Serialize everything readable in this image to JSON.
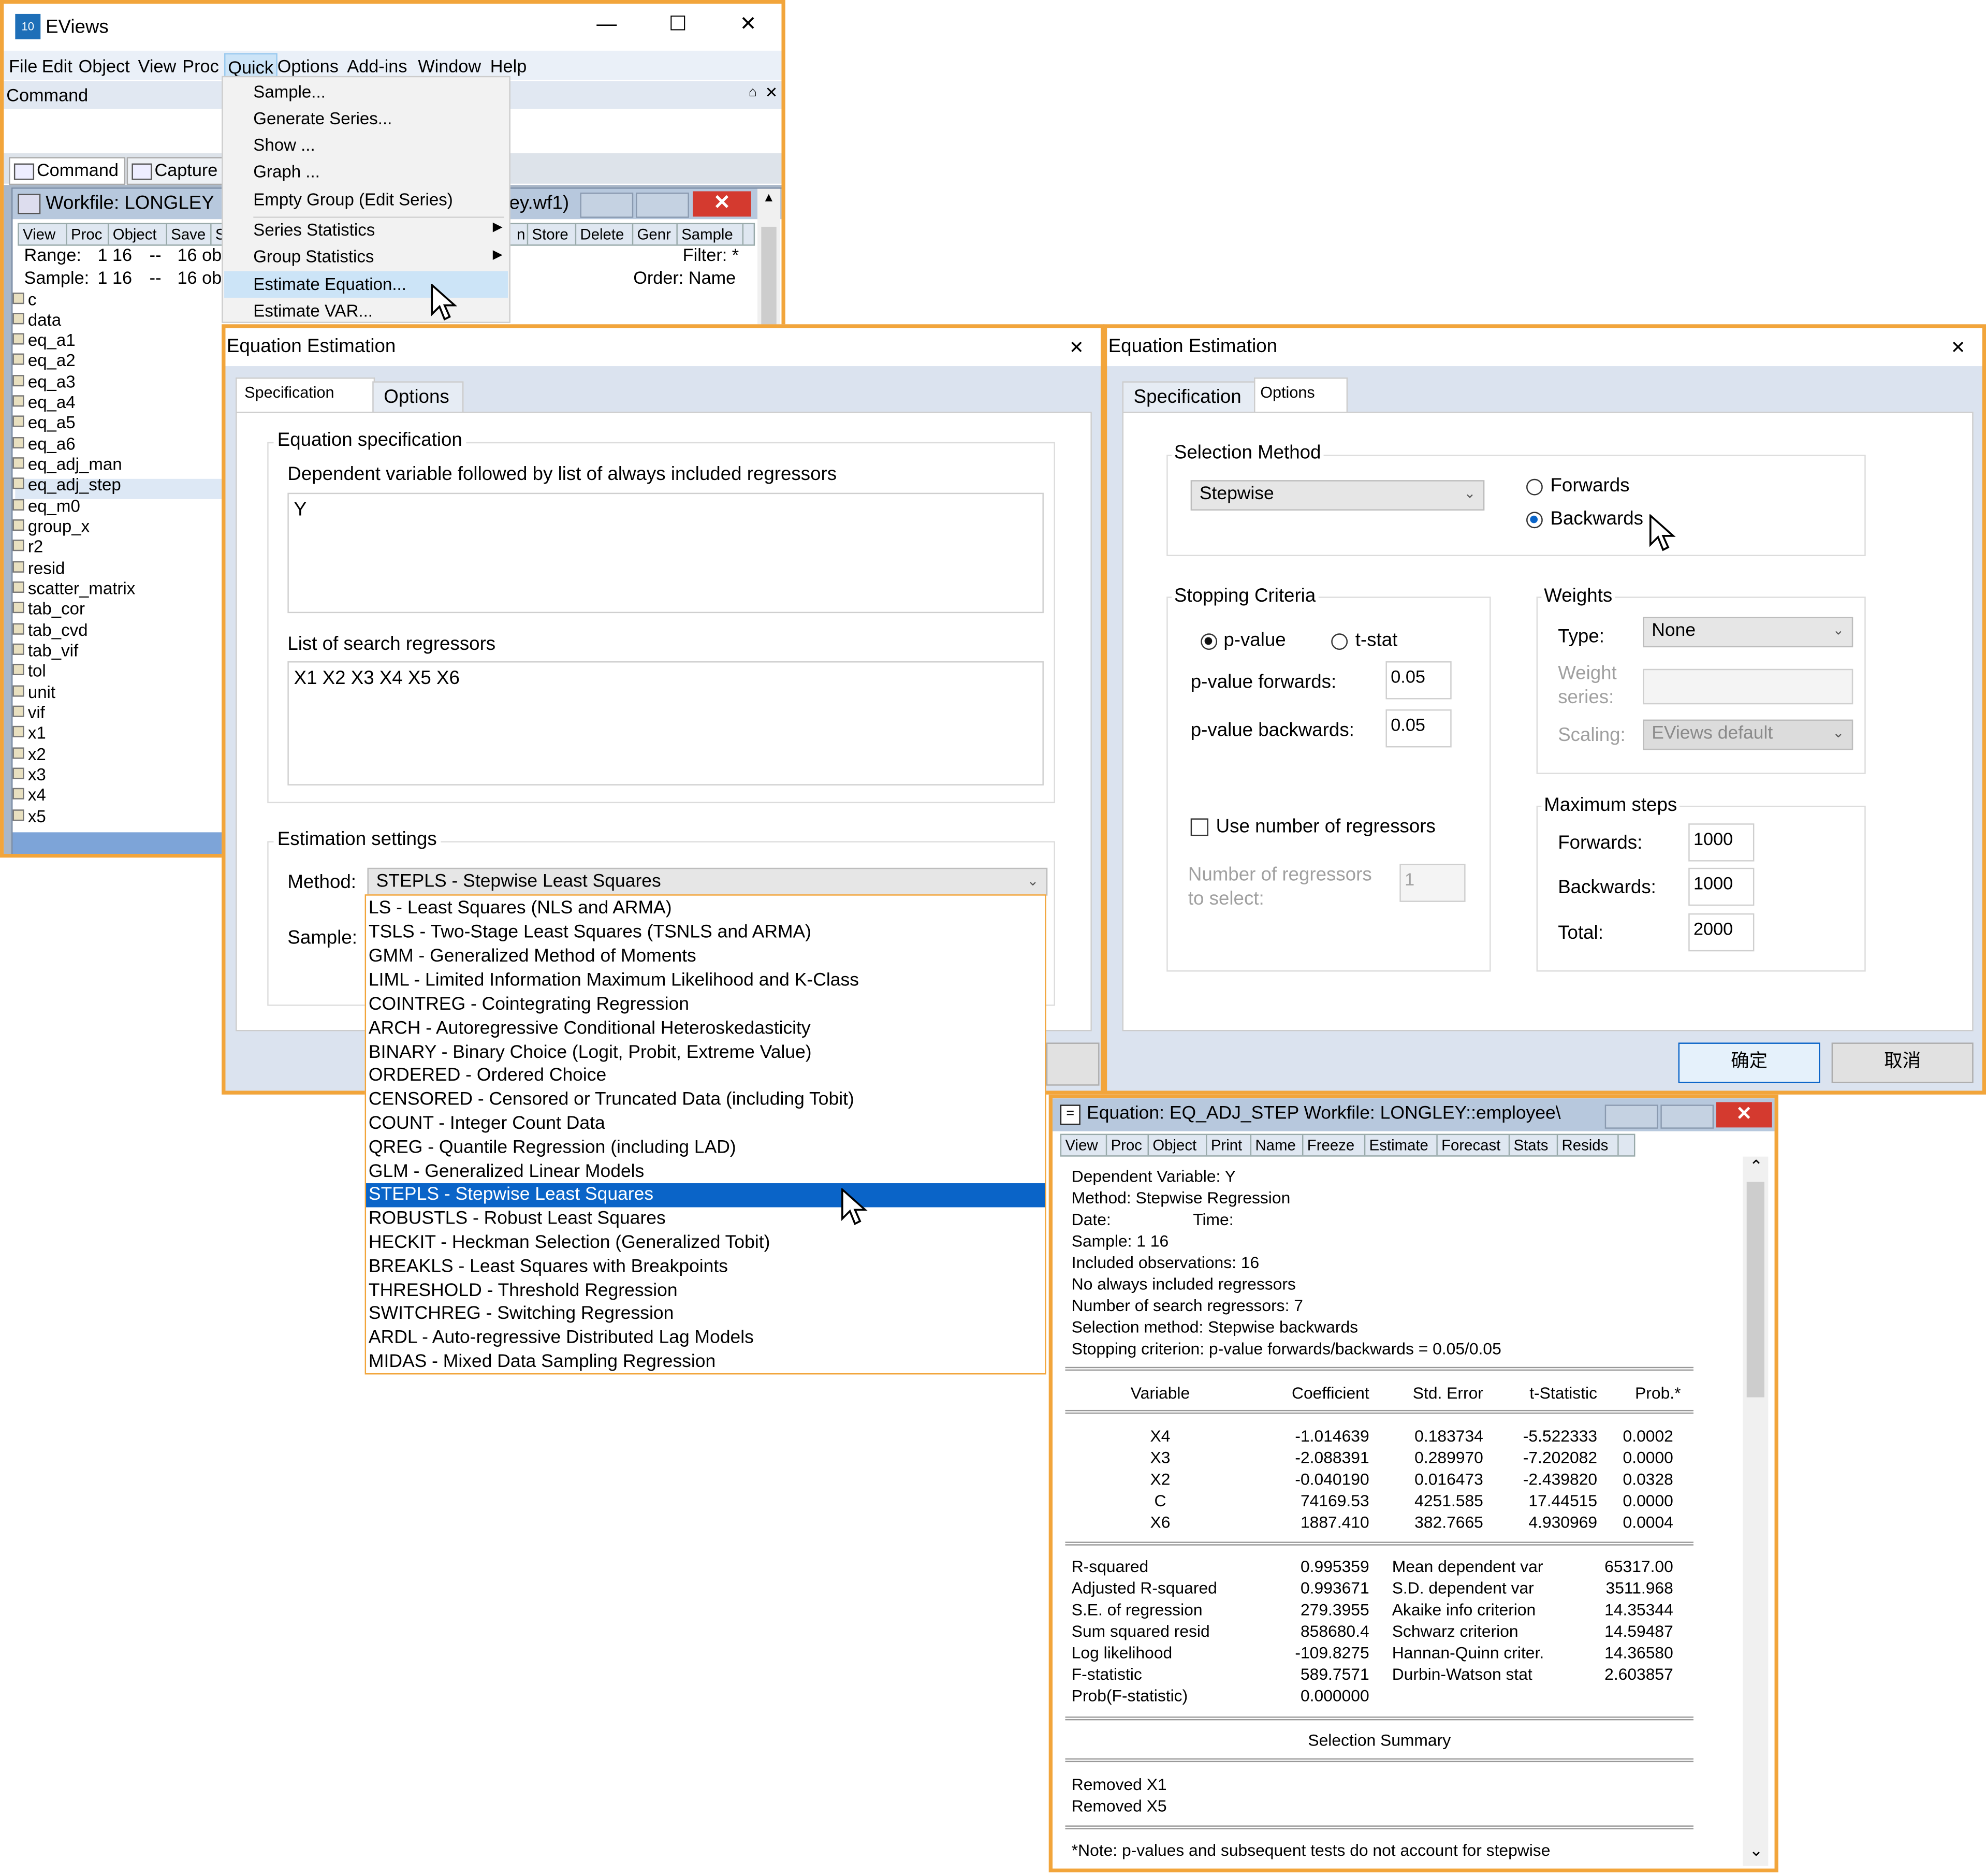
{
  "main": {
    "title": "EViews",
    "menu": [
      "File",
      "Edit",
      "Object",
      "View",
      "Proc",
      "Quick",
      "Options",
      "Add-ins",
      "Window",
      "Help"
    ],
    "command_pane_label": "Command",
    "bottom_tabs": [
      "Command",
      "Capture"
    ],
    "quick_menu": [
      "Sample...",
      "Generate Series...",
      "Show ...",
      "Graph ...",
      "Empty Group (Edit Series)",
      "Series Statistics",
      "Group Statistics",
      "Estimate Equation...",
      "Estimate VAR..."
    ]
  },
  "workfile": {
    "title": "Workfile: LONGLEY",
    "title_tail": "ey.wf1)",
    "toolbar_left": [
      "View",
      "Proc",
      "Object",
      "Save",
      "Sn"
    ],
    "toolbar_right": [
      "n",
      "Store",
      "Delete",
      "Genr",
      "Sample"
    ],
    "range_label": "Range:",
    "range_value": "1 16",
    "range_sep": "--",
    "range_obs": "16 obs",
    "sample_label": "Sample:",
    "sample_value": "1 16",
    "sample_sep": "--",
    "sample_obs": "16 obs",
    "filter": "Filter: *",
    "order": "Order: Name",
    "objects": [
      "c",
      "data",
      "eq_a1",
      "eq_a2",
      "eq_a3",
      "eq_a4",
      "eq_a5",
      "eq_a6",
      "eq_adj_man",
      "eq_adj_step",
      "eq_m0",
      "group_x",
      "r2",
      "resid",
      "scatter_matrix",
      "tab_cor",
      "tab_cvd",
      "tab_vif",
      "tol",
      "unit",
      "vif",
      "x1",
      "x2",
      "x3",
      "x4",
      "x5"
    ]
  },
  "spec_dialog": {
    "title": "Equation Estimation",
    "tabs": [
      "Specification",
      "Options"
    ],
    "group_title": "Equation specification",
    "dep_label": "Dependent variable followed by list of always included regressors",
    "dep_value": "Y",
    "search_label": "List of search regressors",
    "search_value": "X1 X2 X3 X4 X5 X6",
    "settings_title": "Estimation settings",
    "method_label": "Method:",
    "method_value": "STEPLS  -  Stepwise Least Squares",
    "sample_label": "Sample:",
    "method_options": [
      "LS  -  Least Squares (NLS and ARMA)",
      "TSLS  -  Two-Stage Least Squares (TSNLS and ARMA)",
      "GMM  -  Generalized Method of Moments",
      "LIML  -  Limited Information Maximum Likelihood and K-Class",
      "COINTREG  -  Cointegrating Regression",
      "ARCH  -  Autoregressive Conditional Heteroskedasticity",
      "BINARY  -  Binary Choice (Logit, Probit, Extreme Value)",
      "ORDERED  -  Ordered Choice",
      "CENSORED  -  Censored or Truncated Data (including Tobit)",
      "COUNT  -  Integer Count Data",
      "QREG  -  Quantile Regression (including LAD)",
      "GLM  -  Generalized Linear Models",
      "STEPLS  -  Stepwise Least Squares",
      "ROBUSTLS  -  Robust Least Squares",
      "HECKIT  -  Heckman Selection (Generalized Tobit)",
      "BREAKLS  -  Least Squares with Breakpoints",
      "THRESHOLD  -  Threshold Regression",
      "SWITCHREG  -  Switching Regression",
      "ARDL - Auto-regressive Distributed Lag Models",
      "MIDAS - Mixed Data Sampling Regression"
    ],
    "selected_index": 12
  },
  "options_dialog": {
    "title": "Equation Estimation",
    "tabs": [
      "Specification",
      "Options"
    ],
    "selection_method_title": "Selection Method",
    "selection_method_value": "Stepwise",
    "forwards_label": "Forwards",
    "backwards_label": "Backwards",
    "stopping_title": "Stopping Criteria",
    "pvalue_label": "p-value",
    "tstat_label": "t-stat",
    "pf_label": "p-value forwards:",
    "pf_value": "0.05",
    "pb_label": "p-value backwards:",
    "pb_value": "0.05",
    "use_num_label": "Use number of regressors",
    "num_label_1": "Number of regressors",
    "num_label_2": "to select:",
    "num_value": "1",
    "weights_title": "Weights",
    "type_label": "Type:",
    "type_value": "None",
    "weight_series_1": "Weight",
    "weight_series_2": "series:",
    "scaling_label": "Scaling:",
    "scaling_value": "EViews default",
    "max_steps_title": "Maximum steps",
    "forwards_steps_label": "Forwards:",
    "forwards_steps": "1000",
    "backwards_steps_label": "Backwards:",
    "backwards_steps": "1000",
    "total_label": "Total:",
    "total_steps": "2000",
    "ok_label": "确定",
    "cancel_label": "取消"
  },
  "equation_window": {
    "title": "Equation: EQ_ADJ_STEP   Workfile: LONGLEY::employee\\",
    "toolbar": [
      "View",
      "Proc",
      "Object",
      "Print",
      "Name",
      "Freeze",
      "Estimate",
      "Forecast",
      "Stats",
      "Resids"
    ],
    "header_lines": [
      "Dependent Variable: Y",
      "Method: Stepwise Regression",
      "Date:                  Time:",
      "Sample: 1 16",
      "Included observations: 16",
      "No always included regressors",
      "Number of search regressors: 7",
      "Selection method: Stepwise backwards",
      "Stopping criterion: p-value forwards/backwards = 0.05/0.05"
    ],
    "columns": [
      "Variable",
      "Coefficient",
      "Std. Error",
      "t-Statistic",
      "Prob.*"
    ],
    "rows": [
      [
        "X4",
        "-1.014639",
        "0.183734",
        "-5.522333",
        "0.0002"
      ],
      [
        "X3",
        "-2.088391",
        "0.289970",
        "-7.202082",
        "0.0000"
      ],
      [
        "X2",
        "-0.040190",
        "0.016473",
        "-2.439820",
        "0.0328"
      ],
      [
        "C",
        "74169.53",
        "4251.585",
        "17.44515",
        "0.0000"
      ],
      [
        "X6",
        "1887.410",
        "382.7665",
        "4.930969",
        "0.0004"
      ]
    ],
    "stats": [
      [
        "R-squared",
        "0.995359",
        "Mean dependent var",
        "65317.00"
      ],
      [
        "Adjusted R-squared",
        "0.993671",
        "S.D. dependent var",
        "3511.968"
      ],
      [
        "S.E. of regression",
        "279.3955",
        "Akaike info criterion",
        "14.35344"
      ],
      [
        "Sum squared resid",
        "858680.4",
        "Schwarz criterion",
        "14.59487"
      ],
      [
        "Log likelihood",
        "-109.8275",
        "Hannan-Quinn criter.",
        "14.36580"
      ],
      [
        "F-statistic",
        "589.7571",
        "Durbin-Watson stat",
        "2.603857"
      ],
      [
        "Prob(F-statistic)",
        "0.000000",
        "",
        ""
      ]
    ],
    "summary_title": "Selection Summary",
    "summary_lines": [
      "Removed X1",
      "Removed X5"
    ],
    "note": "*Note: p-values and subsequent tests do not account for stepwise"
  }
}
